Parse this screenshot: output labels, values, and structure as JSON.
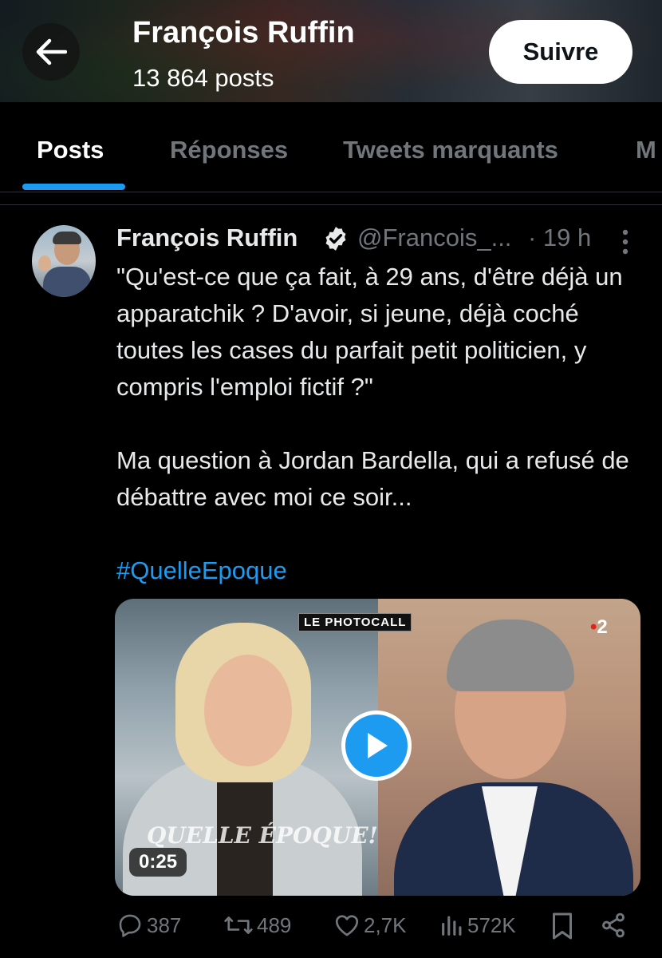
{
  "header": {
    "name": "François Ruffin",
    "posts_count": "13 864 posts",
    "follow_label": "Suivre"
  },
  "tabs": [
    {
      "label": "Posts",
      "active": true
    },
    {
      "label": "Réponses",
      "active": false
    },
    {
      "label": "Tweets marquants",
      "active": false
    },
    {
      "label": "M",
      "active": false
    }
  ],
  "tweet": {
    "author_name": "François Ruffin",
    "handle": "@Francois_...",
    "time": "· 19 h",
    "text_quote": "\"Qu'est-ce que ça fait, à 29 ans, d'être déjà un apparatchik ? D'avoir, si jeune, déjà coché toutes les cases du parfait petit politicien, y compris l'emploi fictif ?\"",
    "text_body": "Ma question à Jordan Bardella, qui a refusé de débattre avec moi ce soir...",
    "hashtag": "#QuelleEpoque",
    "media": {
      "overlay_label": "LE PHOTOCALL",
      "channel": "2",
      "channel_dot": "•",
      "show_logo_text": "QUELLE ÉPOQUE!",
      "duration": "0:25"
    },
    "stats": {
      "replies": "387",
      "reposts": "489",
      "likes": "2,7K",
      "views": "572K"
    }
  },
  "colors": {
    "accent": "#1d9bf0",
    "background": "#000000",
    "muted_text": "#71767b",
    "primary_text": "#e7e9ea"
  }
}
